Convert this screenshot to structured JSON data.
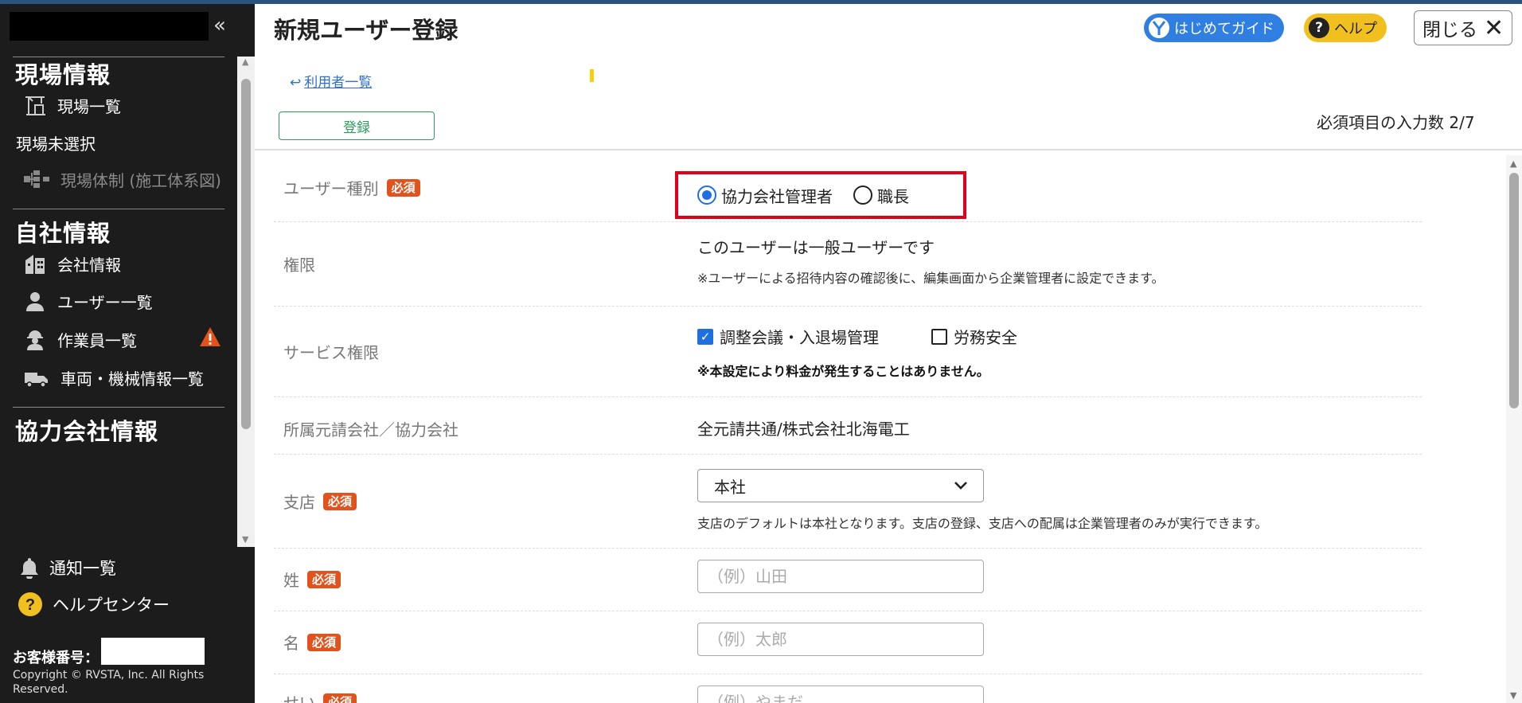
{
  "sidebar": {
    "collapse_icon": "«",
    "sections": {
      "site_info": "現場情報",
      "site_list": "現場一覧",
      "site_unselected": "現場未選択",
      "site_structure": "現場体制 (施工体系図)",
      "company_info": "自社情報",
      "company_details": "会社情報",
      "user_list": "ユーザー一覧",
      "worker_list": "作業員一覧",
      "vehicle_list": "車両・機械情報一覧",
      "partner_info": "協力会社情報"
    },
    "bottom": {
      "notifications": "通知一覧",
      "help_center": "ヘルプセンター",
      "customer_number_label": "お客様番号：",
      "copyright": "Copyright © RVSTA, Inc. All Rights Reserved."
    }
  },
  "header": {
    "title": "新規ユーザー登録",
    "guide_button": "はじめてガイド",
    "help_button": "ヘルプ",
    "close_button": "閉じる",
    "close_icon": "✕"
  },
  "topbar": {
    "back_link": "利用者一覧",
    "register_button": "登録",
    "required_count": "必須項目の入力数 2/7"
  },
  "form": {
    "required_badge": "必須",
    "user_type": {
      "label": "ユーザー種別",
      "options": [
        "協力会社管理者",
        "職長"
      ],
      "selected": "協力会社管理者"
    },
    "permission": {
      "label": "権限",
      "value": "このユーザーは一般ユーザーです",
      "note": "※ユーザーによる招待内容の確認後に、編集画面から企業管理者に設定できます。"
    },
    "service": {
      "label": "サービス権限",
      "options": [
        {
          "label": "調整会議・入退場管理",
          "checked": true
        },
        {
          "label": "労務安全",
          "checked": false
        }
      ],
      "note": "※本設定により料金が発生することはありません。"
    },
    "affiliation": {
      "label": "所属元請会社／協力会社",
      "value": "全元請共通/株式会社北海電工"
    },
    "branch": {
      "label": "支店",
      "selected": "本社",
      "note": "支店のデフォルトは本社となります。支店の登録、支店への配属は企業管理者のみが実行できます。"
    },
    "last_name": {
      "label": "姓",
      "placeholder": "（例）山田"
    },
    "first_name": {
      "label": "名",
      "placeholder": "（例）太郎"
    },
    "last_name_kana": {
      "label": "せい",
      "placeholder": "（例）やまだ"
    }
  },
  "colors": {
    "accent_blue": "#2f7fe3",
    "help_yellow": "#f2c01e",
    "required_orange": "#e2521c",
    "register_green": "#2a9d5a",
    "highlight_red": "#e0001b"
  }
}
